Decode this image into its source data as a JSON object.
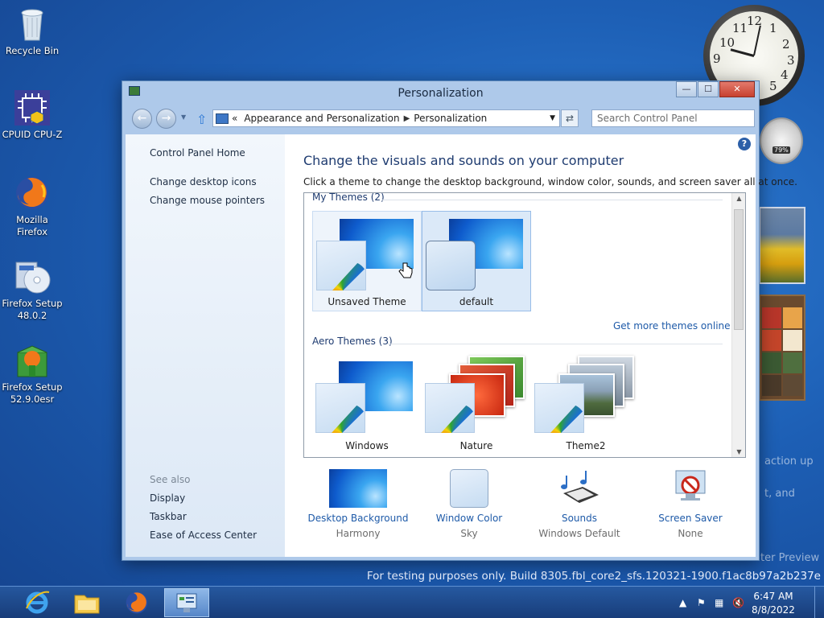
{
  "desktop": {
    "icons": [
      {
        "label": "Recycle Bin"
      },
      {
        "label": "CPUID CPU-Z"
      },
      {
        "label": "Mozilla Firefox"
      },
      {
        "label": "Firefox Setup 48.0.2"
      },
      {
        "label": "Firefox Setup 52.9.0esr"
      }
    ],
    "watermark": "For testing purposes only. Build 8305.fbl_core2_sfs.120321-1900.f1ac8b97a2b237e",
    "faint_lines": [
      "action up",
      "t, and",
      "ter Preview"
    ]
  },
  "gadgets": {
    "clock_numbers": [
      "12",
      "1",
      "2",
      "3",
      "4",
      "5",
      "9",
      "10",
      "11"
    ],
    "meter_badge": "79%"
  },
  "window": {
    "title": "Personalization",
    "controls": {
      "minimize": "—",
      "maximize": "☐",
      "close": "✕"
    },
    "address": {
      "prefix": "«",
      "crumbs": [
        "Appearance and Personalization",
        "Personalization"
      ]
    },
    "search_placeholder": "Search Control Panel",
    "sidebar": {
      "home": "Control Panel Home",
      "links": [
        "Change desktop icons",
        "Change mouse pointers"
      ],
      "see_also_label": "See also",
      "see_also": [
        "Display",
        "Taskbar",
        "Ease of Access Center"
      ]
    },
    "main": {
      "title": "Change the visuals and sounds on your computer",
      "description": "Click a theme to change the desktop background, window color, sounds, and screen saver all at once.",
      "my_themes_label": "My Themes (2)",
      "my_themes": [
        {
          "name": "Unsaved Theme"
        },
        {
          "name": "default"
        }
      ],
      "more_themes": "Get more themes online",
      "aero_label": "Aero Themes (3)",
      "aero_themes": [
        {
          "name": "Windows"
        },
        {
          "name": "Nature"
        },
        {
          "name": "Theme2"
        }
      ],
      "bottom": [
        {
          "title": "Desktop Background",
          "sub": "Harmony"
        },
        {
          "title": "Window Color",
          "sub": "Sky"
        },
        {
          "title": "Sounds",
          "sub": "Windows Default"
        },
        {
          "title": "Screen Saver",
          "sub": "None"
        }
      ]
    }
  },
  "taskbar": {
    "time": "6:47 AM",
    "date": "8/8/2022"
  },
  "colors": {
    "accent_blue": "#1e5aa8",
    "title_blue": "#1e3b70",
    "selection": "#dbe9f8"
  }
}
